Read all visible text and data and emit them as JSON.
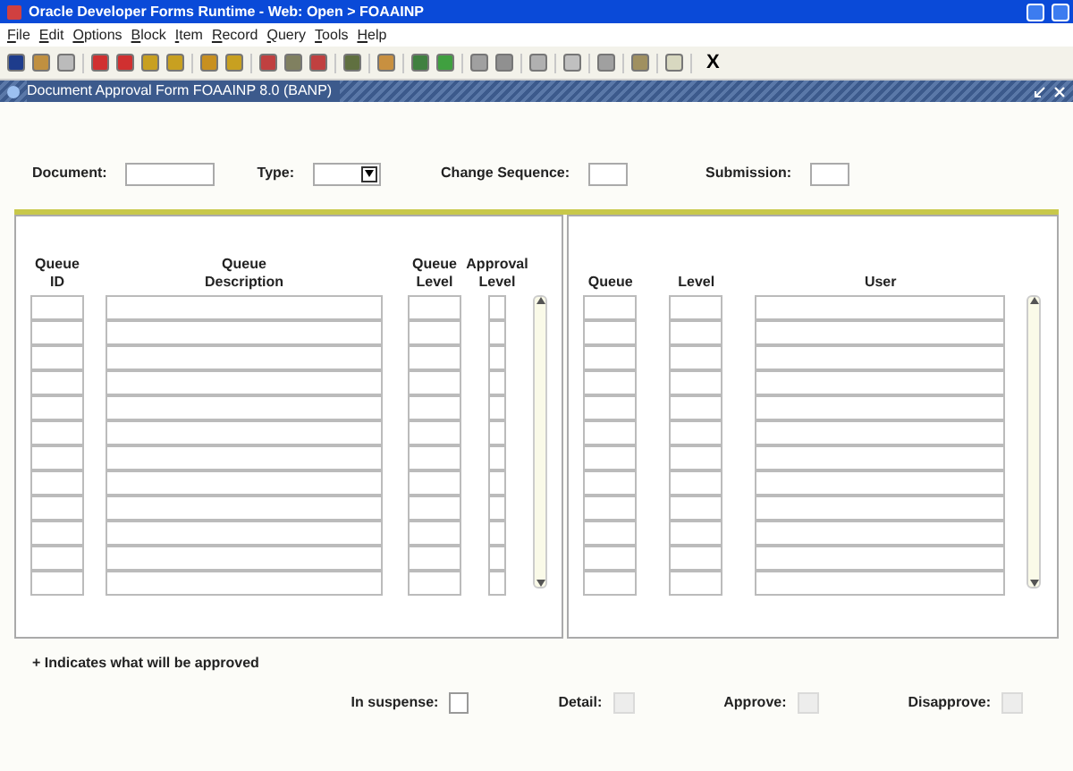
{
  "window": {
    "title": "Oracle Developer Forms Runtime - Web:  Open > FOAAINP"
  },
  "menu": [
    "File",
    "Edit",
    "Options",
    "Block",
    "Item",
    "Record",
    "Query",
    "Tools",
    "Help"
  ],
  "toolbar": {
    "exit_label": "X"
  },
  "form": {
    "title": "Document Approval Form  FOAAINP  8.0  (BANP)"
  },
  "header": [
    {
      "kind": "text",
      "label": "Document:"
    },
    {
      "kind": "dropdown",
      "label": "Type:"
    },
    {
      "kind": "short",
      "label": "Change Sequence:"
    },
    {
      "kind": "short",
      "label": "Submission:"
    }
  ],
  "left_table": {
    "columns": [
      "Queue ID",
      "Queue Description",
      "Queue Level",
      "Approval Level"
    ]
  },
  "right_table": {
    "columns": [
      "Queue",
      "Level",
      "User"
    ]
  },
  "note": "+ Indicates what will be approved",
  "footer": [
    {
      "kind": "checkbox",
      "label": "In suspense:",
      "checked": false
    },
    {
      "kind": "icon",
      "label": "Detail:",
      "disabled": true
    },
    {
      "kind": "icon",
      "label": "Approve:",
      "disabled": true
    },
    {
      "kind": "icon",
      "label": "Disapprove:",
      "disabled": true
    }
  ]
}
